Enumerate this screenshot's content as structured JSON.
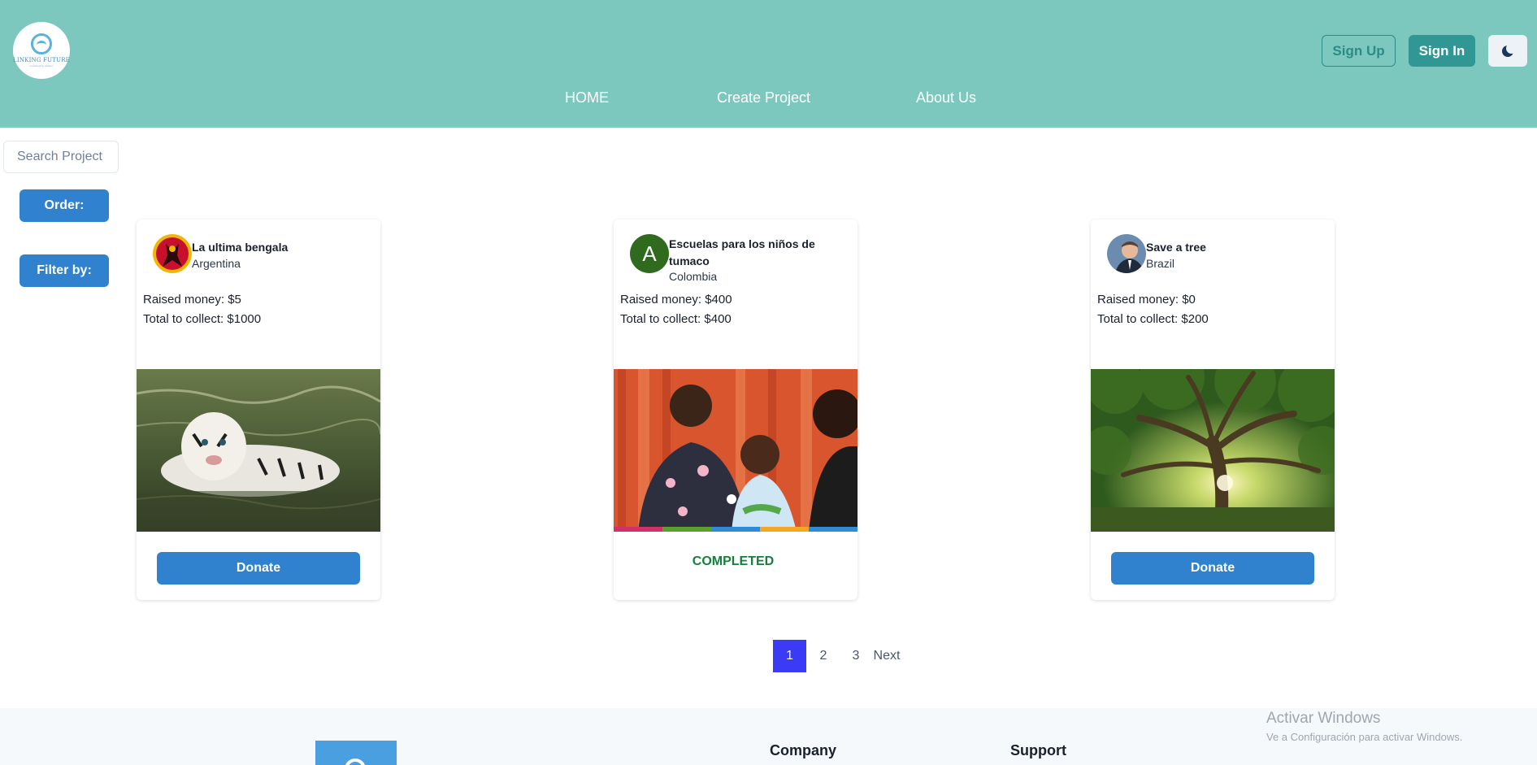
{
  "header": {
    "logo_text": "LINKING FUTURE",
    "logo_sub": "crowdfunding platform",
    "nav": {
      "home": "HOME",
      "create": "Create Project",
      "about": "About Us"
    },
    "sign_up": "Sign Up",
    "sign_in": "Sign In",
    "theme_icon": "moon-icon"
  },
  "sidebar": {
    "search_placeholder": "Search Project",
    "order_label": "Order:",
    "filter_label": "Filter by:"
  },
  "projects": [
    {
      "title": "La ultima bengala",
      "country": "Argentina",
      "raised": "Raised money: $5",
      "total": "Total to collect: $1000",
      "action": "Donate",
      "image": "white-tiger-in-water"
    },
    {
      "title": "Escuelas para los niños de tumaco",
      "country": "Colombia",
      "raised": "Raised money: $400",
      "total": "Total to collect: $400",
      "avatar_letter": "A",
      "status": "COMPLETED",
      "image": "mother-and-children-smiling"
    },
    {
      "title": "Save a tree",
      "country": "Brazil",
      "raised": "Raised money: $0",
      "total": "Total to collect: $200",
      "action": "Donate",
      "image": "large-tree-forest-sunlight"
    }
  ],
  "pagination": {
    "pages": [
      "1",
      "2",
      "3"
    ],
    "current": "1",
    "next": "Next"
  },
  "footer": {
    "company": "Company",
    "support": "Support"
  },
  "windows_notice": {
    "title": "Activar Windows",
    "subtitle": "Ve a Configuración para activar Windows."
  },
  "colors": {
    "header_bg": "#7cc8be",
    "primary": "#3182ce",
    "teal": "#319795",
    "completed": "#15803d",
    "page_active": "#3b3bf5"
  }
}
